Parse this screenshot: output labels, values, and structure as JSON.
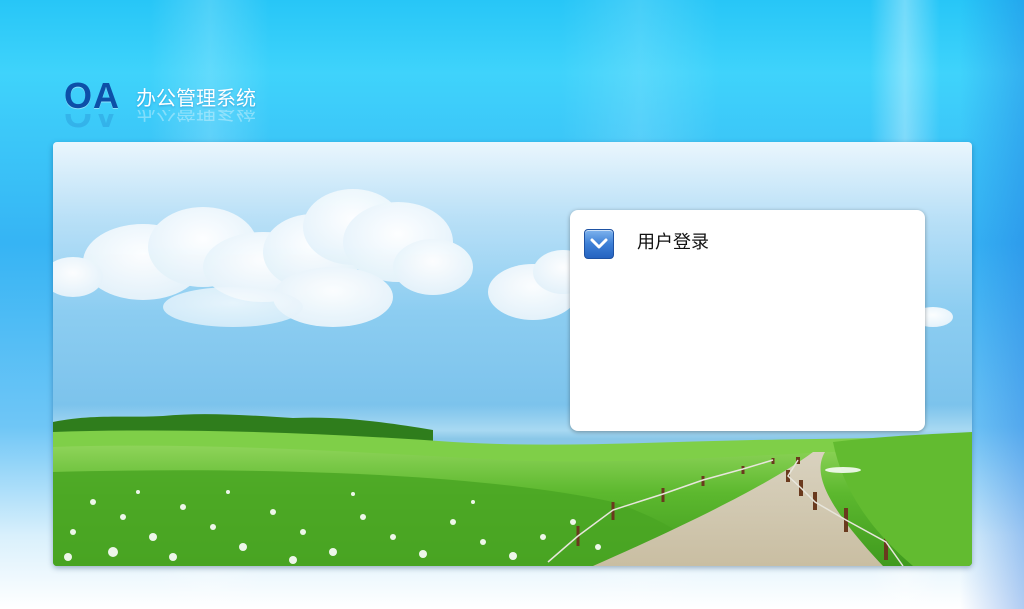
{
  "app": {
    "logo_text": "OA",
    "system_name": "办公管理系统"
  },
  "login": {
    "title": "用户登录",
    "icon": "chevron-down-icon"
  },
  "colors": {
    "background_top": "#27c6f7",
    "logo_blue": "#0d4fa8",
    "icon_blue": "#3d7fd6",
    "grass_green": "#5cb82e"
  }
}
